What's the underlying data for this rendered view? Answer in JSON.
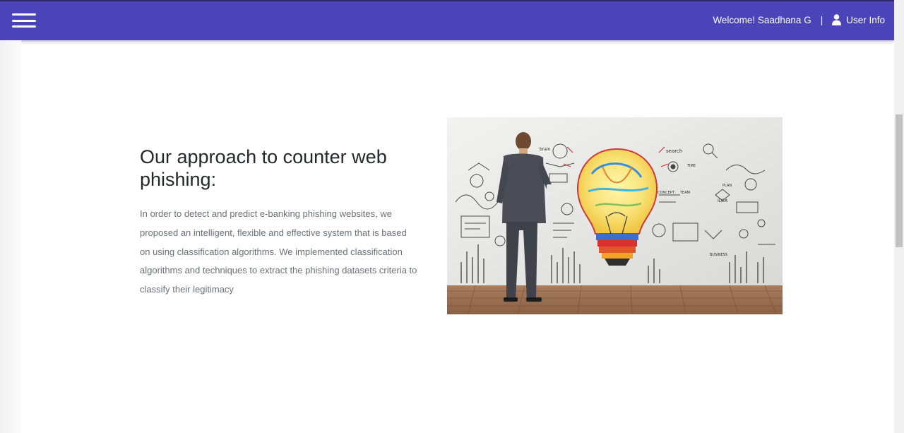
{
  "navbar": {
    "menu_icon": "hamburger-icon",
    "welcome_text": "Welcome! Saadhana G",
    "separator": "|",
    "user_icon": "user-icon",
    "user_info_label": "User Info",
    "background_color": "#4a44b8"
  },
  "section": {
    "title": "Our approach to counter web phishing:",
    "body": "In order to detect and predict e-banking phishing websites, we proposed an intelligent, flexible and effective system that is based on using classification algorithms. We implemented classification algorithms and techniques to extract the phishing datasets criteria to classify their legitimacy",
    "image_subject": "businessman-lightbulb-illustration",
    "image_words": {
      "brain": "brain",
      "search": "search",
      "time": "TIME",
      "concept": "CONCEPT",
      "team": "TEAM",
      "idea": "IDEA",
      "plan": "PLAN",
      "business": "BUSINESS"
    }
  },
  "scrollbar": {
    "position_fraction": 0.26
  }
}
